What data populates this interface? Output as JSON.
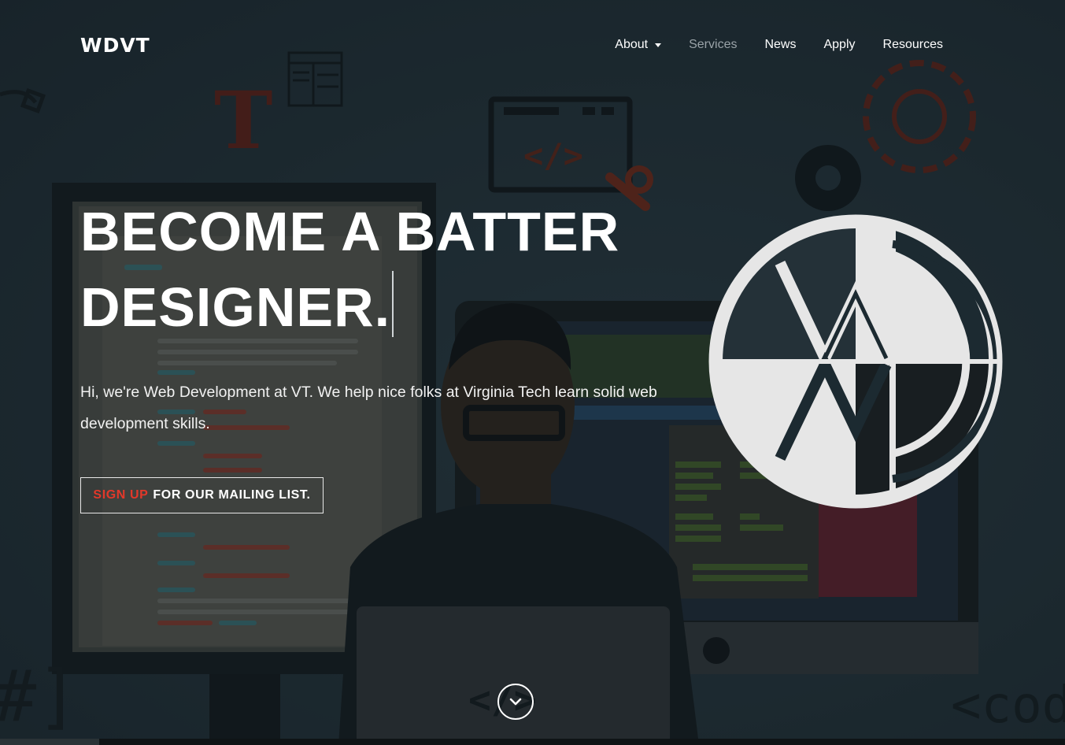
{
  "brand": {
    "name": "WDVT"
  },
  "nav": {
    "items": [
      {
        "label": "About",
        "dropdown": true
      },
      {
        "label": "Services",
        "active": true
      },
      {
        "label": "News"
      },
      {
        "label": "Apply"
      },
      {
        "label": "Resources"
      }
    ]
  },
  "hero": {
    "headline_line1": "BECOME A BATTER",
    "headline_line2": "DESIGNER.",
    "intro": "Hi, we're Web Development at VT. We help nice folks at Virginia Tech learn solid web development skills.",
    "cta_accent": "SIGN UP",
    "cta_rest": "FOR OUR MAILING LIST.",
    "bg_code_text": "<cod",
    "bg_code_tag": "</>"
  },
  "colors": {
    "background": "#1e2b33",
    "accent": "#e2382a",
    "text": "#ffffff",
    "muted_nav": "#9aa3a8"
  },
  "icons": {
    "scroll": "chevron-down-icon",
    "emblem": "wd-logo-icon"
  }
}
